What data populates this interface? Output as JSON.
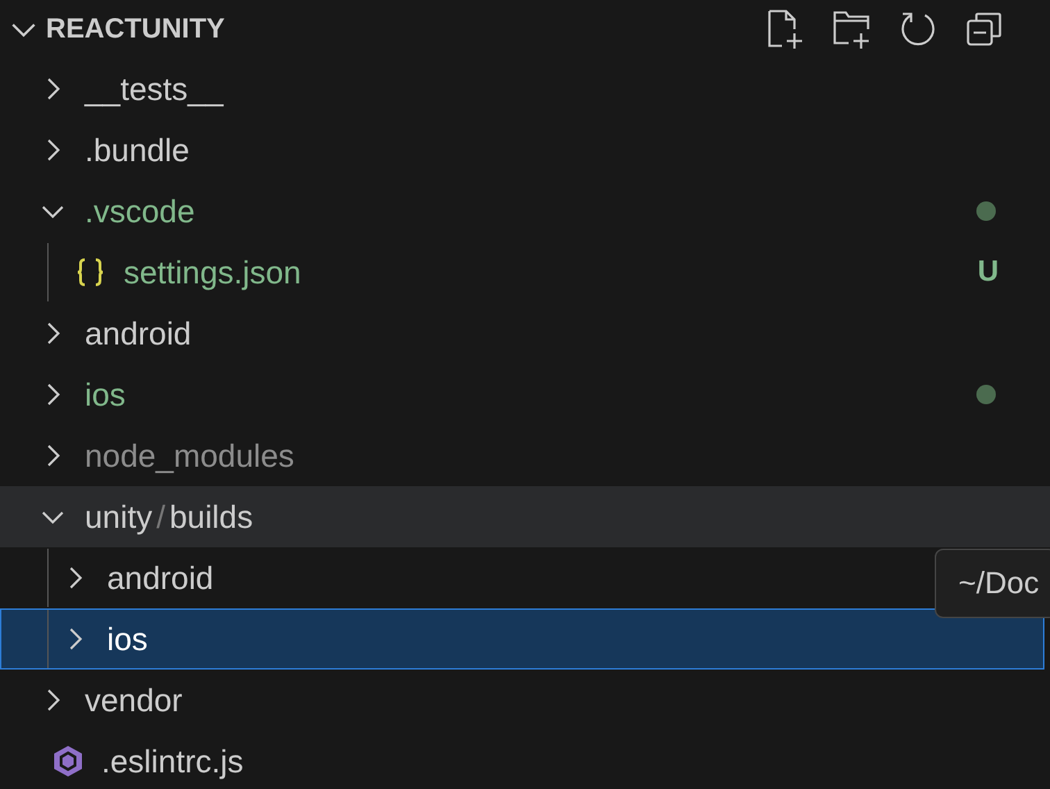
{
  "header": {
    "title": "REACTUNITY",
    "expanded": true
  },
  "tree": [
    {
      "name": "__tests__",
      "kind": "folder",
      "expanded": false,
      "selected": false
    },
    {
      "name": ".bundle",
      "kind": "folder",
      "expanded": false,
      "selected": false
    },
    {
      "name": ".vscode",
      "kind": "folder",
      "expanded": true,
      "selected": false,
      "modified": true,
      "children": [
        {
          "name": "settings.json",
          "kind": "json",
          "selected": false,
          "untracked": true,
          "badge": "U"
        }
      ]
    },
    {
      "name": "android",
      "kind": "folder",
      "expanded": false,
      "selected": false
    },
    {
      "name": "ios",
      "kind": "folder",
      "expanded": false,
      "selected": false,
      "modified": true
    },
    {
      "name": "node_modules",
      "kind": "folder",
      "expanded": false,
      "selected": false,
      "ignored": true
    },
    {
      "path": [
        "unity",
        "builds"
      ],
      "separator": "/",
      "kind": "folder",
      "expanded": true,
      "selected": false,
      "hovered": true,
      "children": [
        {
          "name": "android",
          "kind": "folder",
          "expanded": false,
          "selected": false
        },
        {
          "name": "ios",
          "kind": "folder",
          "expanded": false,
          "selected": true
        }
      ]
    },
    {
      "name": "vendor",
      "kind": "folder",
      "expanded": false,
      "selected": false
    },
    {
      "name": ".eslintrc.js",
      "kind": "eslint",
      "selected": false
    }
  ],
  "tooltip": {
    "text": "~/Doc"
  }
}
